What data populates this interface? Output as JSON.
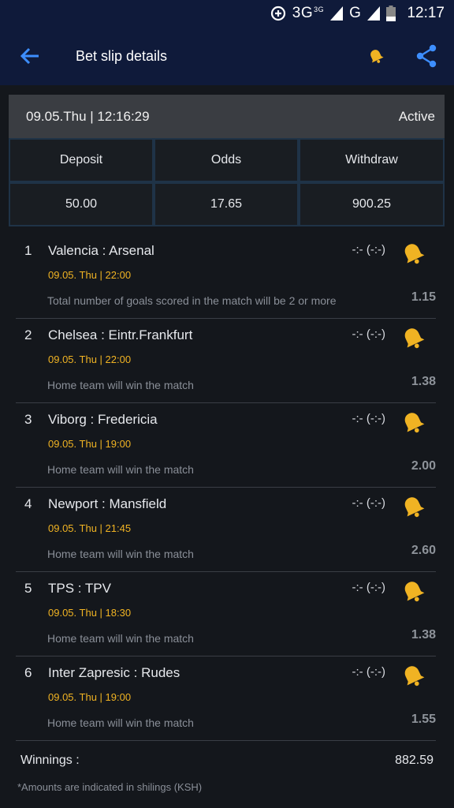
{
  "status_bar": {
    "network_3g": "3G",
    "network_3g_sup": "3G",
    "network_g": "G",
    "time": "12:17"
  },
  "app_bar": {
    "title": "Bet slip details",
    "icons": [
      "back-arrow-icon",
      "bell-icon",
      "share-icon"
    ],
    "accent_color": "#f0b323",
    "link_color": "#3d8eff"
  },
  "summary": {
    "datetime": "09.05.Thu | 12:16:29",
    "status": "Active",
    "headers": [
      "Deposit",
      "Odds",
      "Withdraw"
    ],
    "values": [
      "50.00",
      "17.65",
      "900.25"
    ]
  },
  "bets": [
    {
      "num": "1",
      "match": "Valencia : Arsenal",
      "score": "-:- (-:-)",
      "time": "09.05. Thu | 22:00",
      "desc": "Total number of goals scored in the match will be 2 or more",
      "odds": "1.15"
    },
    {
      "num": "2",
      "match": "Chelsea : Eintr.Frankfurt",
      "score": "-:- (-:-)",
      "time": "09.05. Thu | 22:00",
      "desc": "Home team will win the match",
      "odds": "1.38"
    },
    {
      "num": "3",
      "match": "Viborg : Fredericia",
      "score": "-:- (-:-)",
      "time": "09.05. Thu | 19:00",
      "desc": "Home team will win the match",
      "odds": "2.00"
    },
    {
      "num": "4",
      "match": "Newport : Mansfield",
      "score": "-:- (-:-)",
      "time": "09.05. Thu | 21:45",
      "desc": "Home team will win the match",
      "odds": "2.60"
    },
    {
      "num": "5",
      "match": "TPS : TPV",
      "score": "-:- (-:-)",
      "time": "09.05. Thu | 18:30",
      "desc": "Home team will win the match",
      "odds": "1.38"
    },
    {
      "num": "6",
      "match": "Inter Zapresic : Rudes",
      "score": "-:- (-:-)",
      "time": "09.05. Thu | 19:00",
      "desc": "Home team will win the match",
      "odds": "1.55"
    }
  ],
  "winnings": {
    "label": "Winnings :",
    "value": "882.59"
  },
  "note": "*Amounts are indicated in shilings (KSH)"
}
